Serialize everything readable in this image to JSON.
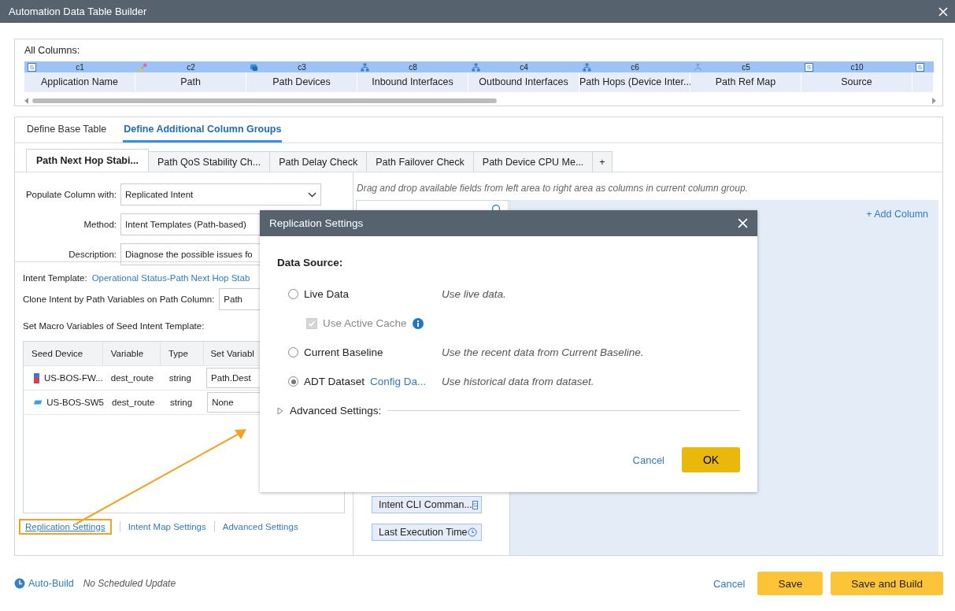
{
  "window": {
    "title": "Automation Data Table Builder"
  },
  "all_columns": {
    "label": "All Columns:",
    "columns": [
      {
        "kind": "string",
        "badge": "S",
        "code": "c1",
        "name": "Application Name"
      },
      {
        "kind": "path",
        "code": "c2",
        "name": "Path"
      },
      {
        "kind": "devices",
        "code": "c3",
        "name": "Path Devices"
      },
      {
        "kind": "interfaces",
        "code": "c8",
        "name": "Inbound Interfaces"
      },
      {
        "kind": "interfaces",
        "code": "c4",
        "name": "Outbound Interfaces"
      },
      {
        "kind": "interfaces",
        "code": "c6",
        "name": "Path Hops (Device Inter..."
      },
      {
        "kind": "map",
        "code": "c5",
        "name": "Path Ref Map"
      },
      {
        "kind": "string",
        "badge": "S",
        "code": "c10",
        "name": "Source"
      },
      {
        "kind": "string",
        "badge": "S"
      }
    ]
  },
  "main_tabs": [
    {
      "label": "Define Base Table",
      "selected": false
    },
    {
      "label": "Define Additional Column Groups",
      "selected": true
    }
  ],
  "group_tabs": [
    {
      "label": "Path Next Hop Stabi...",
      "selected": true
    },
    {
      "label": "Path QoS Stability Ch...",
      "selected": false
    },
    {
      "label": "Path Delay Check",
      "selected": false
    },
    {
      "label": "Path Failover Check",
      "selected": false
    },
    {
      "label": "Path Device CPU Me...",
      "selected": false
    }
  ],
  "add_tab": "+",
  "form": {
    "fields": [
      {
        "kind": "dropdown",
        "label": "Populate Column with:",
        "value": "Replicated Intent"
      },
      {
        "kind": "text",
        "label": "Method:",
        "value": "Intent Templates (Path-based)"
      },
      {
        "kind": "text",
        "label": "Description:",
        "value": "Diagnose the possible issues fo"
      }
    ],
    "intent_template_label": "Intent Template:",
    "intent_template": "Operational Status-Path Next Hop Stab",
    "clone_label": "Clone Intent by Path Variables on Path Column:",
    "clone_value": "Path",
    "macro_label": "Set Macro Variables of Seed Intent Template:",
    "table": {
      "columns": [
        "Seed Device",
        "Variable",
        "Type",
        "Set Variabl"
      ],
      "rows": [
        {
          "kind": "firewall",
          "device": "US-BOS-FW...",
          "variable": "dest_route",
          "type": "string",
          "value": "Path.Dest"
        },
        {
          "kind": "switch",
          "device": "US-BOS-SW5",
          "variable": "dest_route",
          "type": "string",
          "value": "None"
        }
      ]
    },
    "links": [
      {
        "label": "Replication Settings",
        "highlighted": true
      },
      {
        "label": "Intent Map Settings",
        "highlighted": false
      },
      {
        "label": "Advanced Settings",
        "highlighted": false
      }
    ]
  },
  "fields_area": {
    "hint": "Drag and drop available fields from left area to right area as columns in current column group.",
    "add_column": "+ Add Column",
    "fields": [
      {
        "kind": "string",
        "badge": "S",
        "label": "Intent CLI Comman..."
      },
      {
        "kind": "time",
        "label": "Last Execution Time"
      }
    ]
  },
  "footer": {
    "auto_build": "Auto-Build",
    "schedule": "No Scheduled Update",
    "buttons": [
      {
        "kind": "link",
        "label": "Cancel"
      },
      {
        "kind": "primary",
        "label": "Save"
      },
      {
        "kind": "primary",
        "label": "Save and Build"
      }
    ]
  },
  "dialog": {
    "title": "Replication Settings",
    "section": "Data Source:",
    "options": [
      {
        "label": "Live Data",
        "description": "Use live data.",
        "selected": false,
        "sub": {
          "label": "Use Active Cache",
          "checked": true,
          "disabled": true
        }
      },
      {
        "label": "Current Baseline",
        "description": "Use the recent data from Current Baseline.",
        "selected": false
      },
      {
        "label": "ADT Dataset",
        "link": "Config Da...",
        "description": "Use historical data from dataset.",
        "selected": true
      }
    ],
    "advanced": {
      "label": "Advanced Settings:",
      "expanded": false
    },
    "buttons": [
      {
        "kind": "link",
        "label": "Cancel"
      },
      {
        "kind": "primary",
        "label": "OK"
      }
    ]
  }
}
